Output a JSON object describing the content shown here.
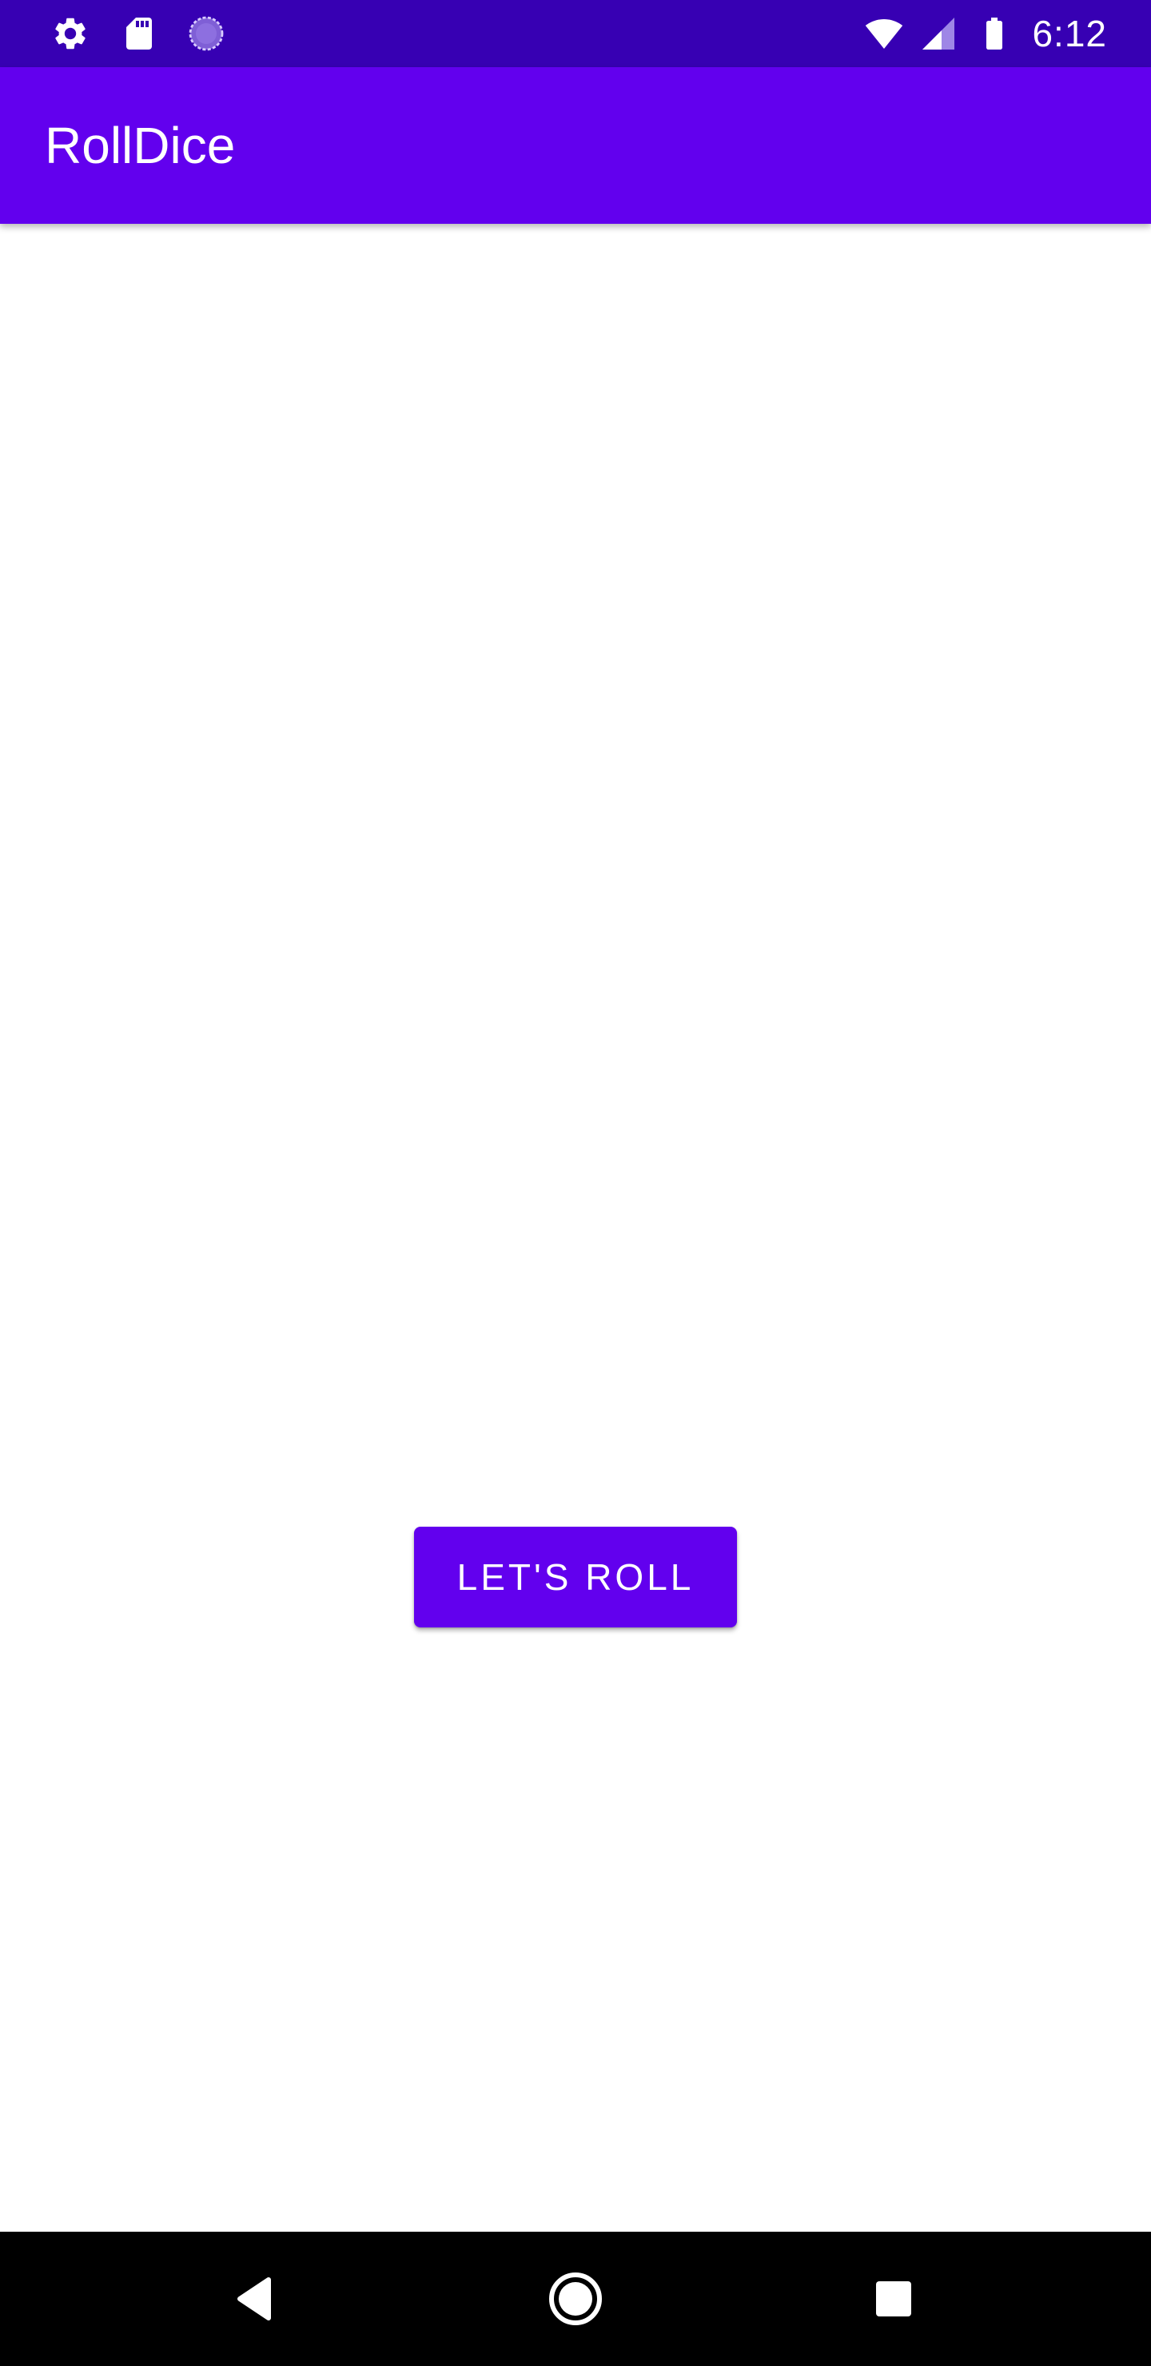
{
  "status_bar": {
    "time": "6:12",
    "icons_left": [
      "settings-icon",
      "sd-card-icon",
      "sync-icon"
    ],
    "icons_right": [
      "wifi-icon",
      "cell-signal-icon",
      "battery-icon"
    ]
  },
  "app_bar": {
    "title": "RollDice"
  },
  "main": {
    "roll_button_label": "LET'S ROLL"
  },
  "nav_bar": {
    "buttons": [
      "back-icon",
      "home-icon",
      "recents-icon"
    ]
  },
  "colors": {
    "status_bar": "#3700b3",
    "primary": "#6200ee",
    "background": "#ffffff",
    "nav_bar": "#000000"
  }
}
